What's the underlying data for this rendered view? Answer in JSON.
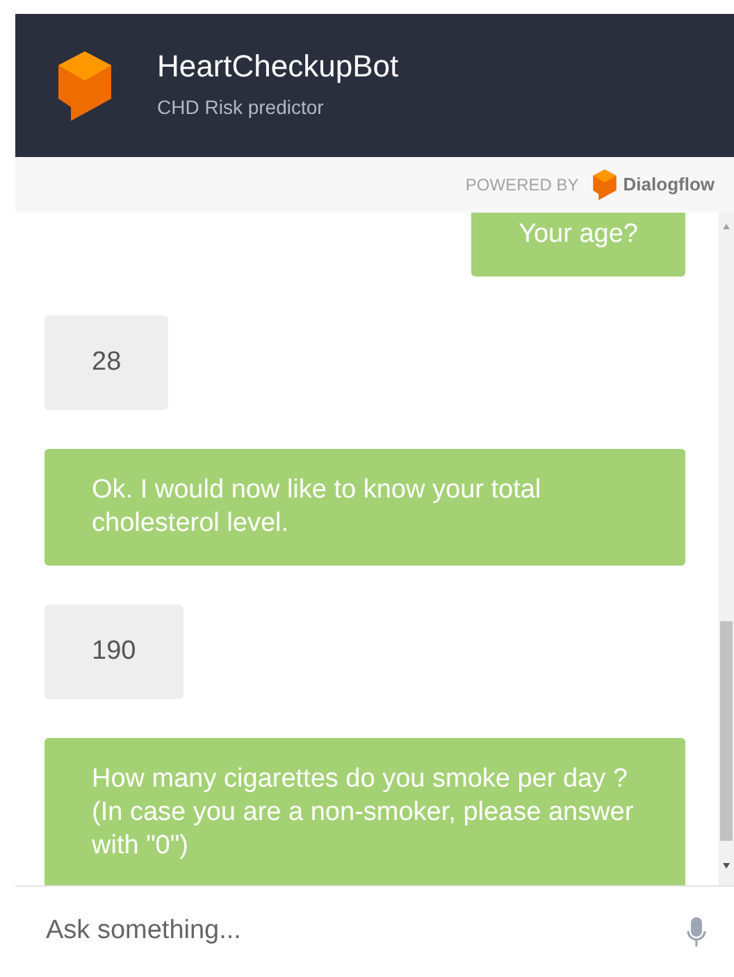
{
  "header": {
    "title": "HeartCheckupBot",
    "subtitle": "CHD Risk predictor"
  },
  "powered_by": {
    "label": "POWERED BY",
    "brand": "Dialogflow"
  },
  "messages": [
    {
      "kind": "bot",
      "text": "Your age?"
    },
    {
      "kind": "user",
      "text": "28"
    },
    {
      "kind": "bot",
      "text": "Ok. I would now like to know your total cholesterol level."
    },
    {
      "kind": "user",
      "text": "190"
    },
    {
      "kind": "bot",
      "text": "How many cigarettes do you smoke per day ? (In case you are a non-smoker, please answer with \"0\")"
    }
  ],
  "input": {
    "placeholder": "Ask something..."
  }
}
